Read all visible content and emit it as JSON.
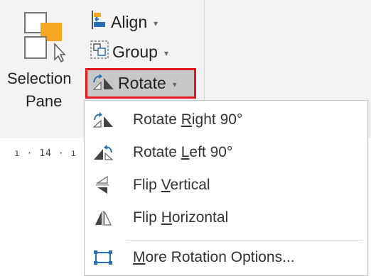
{
  "ribbon": {
    "selection_pane": {
      "line1": "Selection",
      "line2": "Pane"
    },
    "align": {
      "label": "Align",
      "caret": "▾"
    },
    "group": {
      "label": "Group",
      "caret": "▾"
    },
    "rotate": {
      "label": "Rotate",
      "caret": "▾"
    },
    "ruler_text": "ı · 14 · ı"
  },
  "menu": {
    "items": [
      {
        "pre": "Rotate ",
        "accel": "R",
        "post": "ight 90°",
        "icon": "rotate-right-icon"
      },
      {
        "pre": "Rotate ",
        "accel": "L",
        "post": "eft 90°",
        "icon": "rotate-left-icon"
      },
      {
        "pre": "Flip ",
        "accel": "V",
        "post": "ertical",
        "icon": "flip-vertical-icon"
      },
      {
        "pre": "Flip ",
        "accel": "H",
        "post": "orizontal",
        "icon": "flip-horizontal-icon"
      },
      {
        "pre": "",
        "accel": "M",
        "post": "ore Rotation Options...",
        "icon": "more-rotation-icon"
      }
    ]
  },
  "colors": {
    "ribbon_bg": "#f3f3f3",
    "highlight_border": "#e2171d",
    "accent_orange": "#f5a623",
    "accent_blue": "#2b6fb6"
  }
}
